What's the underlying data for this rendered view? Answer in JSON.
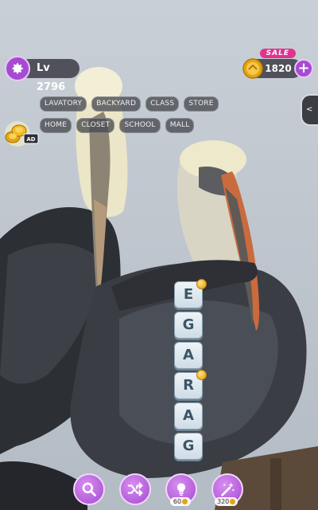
{
  "header": {
    "level_text": "Lv 2796",
    "coins_text": "1820",
    "sale_text": "SALE",
    "plus_text": "+"
  },
  "categories": [
    "LAVATORY",
    "BACKYARD",
    "CLASS",
    "STORE",
    "HOME",
    "CLOSET",
    "SCHOOL",
    "MALL"
  ],
  "ad_reward": {
    "badge_text": "AD"
  },
  "side_tab": {
    "arrow": "<"
  },
  "letters": [
    {
      "char": "E",
      "hint_coin": true
    },
    {
      "char": "G",
      "hint_coin": false
    },
    {
      "char": "A",
      "hint_coin": false
    },
    {
      "char": "R",
      "hint_coin": true
    },
    {
      "char": "A",
      "hint_coin": false
    },
    {
      "char": "G",
      "hint_coin": false
    }
  ],
  "tools": {
    "search": {
      "cost": ""
    },
    "shuffle": {
      "cost": ""
    },
    "hint": {
      "cost": "60"
    },
    "magic": {
      "cost": "320"
    }
  },
  "colors": {
    "accent": "#a64bd1",
    "coin": "#e5a511"
  },
  "icons": [
    "gear-icon",
    "coin-icon",
    "search-icon",
    "shuffle-icon",
    "lightbulb-icon",
    "magic-wand-icon",
    "video-ad-icon",
    "chevron-left-icon"
  ]
}
